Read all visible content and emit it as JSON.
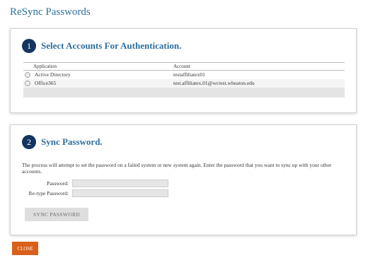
{
  "page": {
    "title": "ReSync Passwords"
  },
  "step1": {
    "number": "1",
    "title": "Select Accounts For Authentication.",
    "columns": {
      "application": "Application",
      "account": "Account"
    },
    "rows": [
      {
        "application": "Active Directory",
        "account": "testaffiliatex01"
      },
      {
        "application": "Office365",
        "account": "test.affiliatex.01@wctest.wheaton.edu"
      }
    ]
  },
  "step2": {
    "number": "2",
    "title": "Sync Password.",
    "description": "The process will attempt to set the password on a failed system or new system again. Enter the password that you want to sync up with your other accounts.",
    "password_label": "Password:",
    "password_value": "",
    "retype_label": "Re-type Password:",
    "retype_value": "",
    "sync_button": "SYNC PASSWORD"
  },
  "footer": {
    "close_button": "CLOSE"
  },
  "colors": {
    "title_blue": "#2e6f9e",
    "step_circle": "#13355f",
    "close_orange": "#d9601a"
  }
}
